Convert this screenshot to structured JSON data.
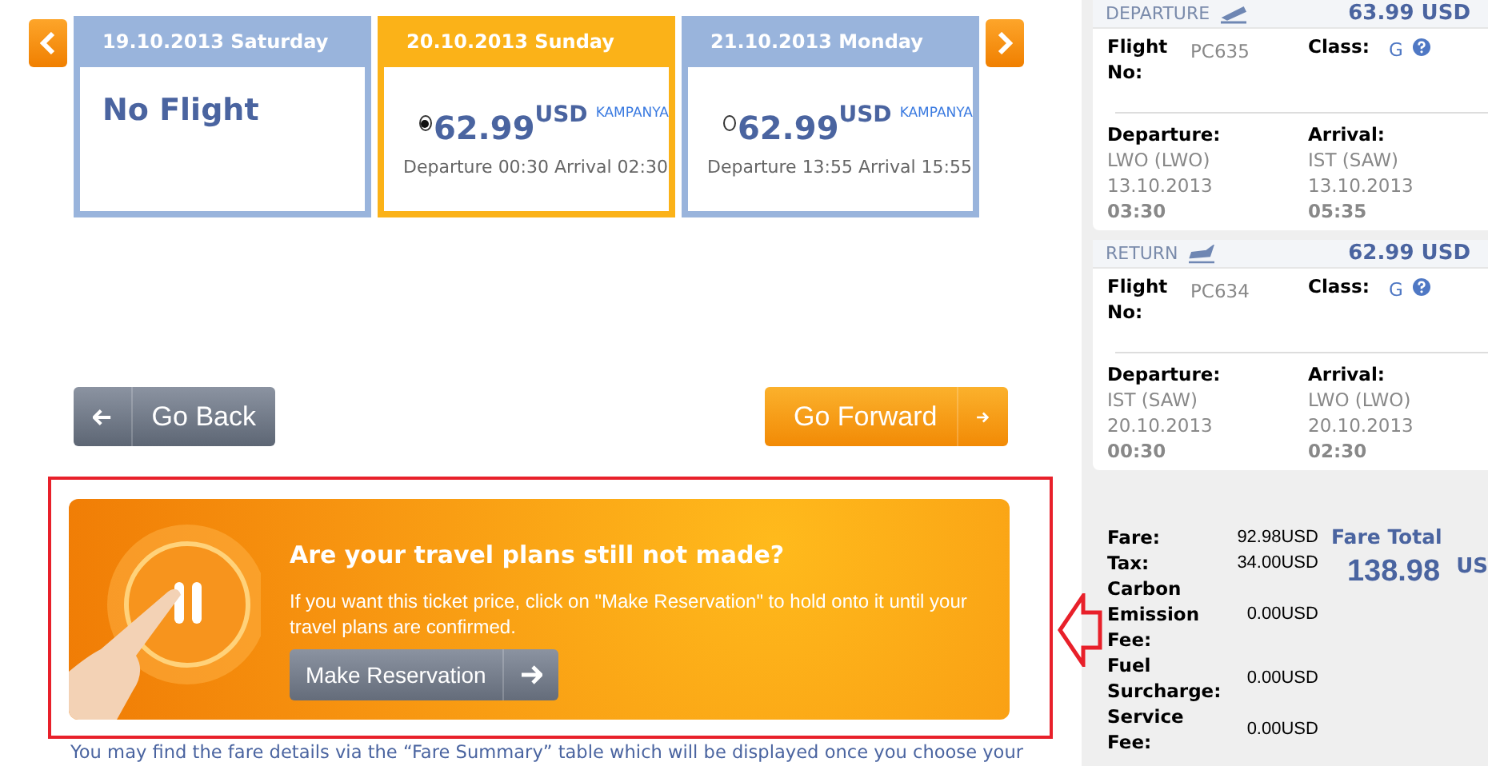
{
  "days": [
    {
      "kind": "no_flight",
      "date": "19.10.2013 Saturday",
      "selected": false,
      "message": "No Flight"
    },
    {
      "kind": "fare",
      "date": "20.10.2013 Sunday",
      "selected": true,
      "price": "62.99",
      "currency": "USD",
      "tag": "KAMPANYA",
      "times": "Departure 00:30 Arrival 02:30"
    },
    {
      "kind": "fare",
      "date": "21.10.2013 Monday",
      "selected": false,
      "price": "62.99",
      "currency": "USD",
      "tag": "KAMPANYA",
      "times": "Departure 13:55 Arrival 15:55"
    }
  ],
  "buttons": {
    "back": "Go Back",
    "forward": "Go Forward"
  },
  "banner": {
    "title": "Are your travel plans still not made?",
    "text": "If you want this ticket price, click on \"Make Reservation\" to hold onto it until your travel plans are confirmed.",
    "button": "Make Reservation"
  },
  "footer_note": "You may find the fare details via the “Fare Summary” table which will be displayed once you choose your",
  "flights": [
    {
      "kind": "departure",
      "direction": "DEPARTURE",
      "price": "63.99 USD",
      "flight_no_label": "Flight No:",
      "flight_no": "PC635",
      "class_label": "Class:",
      "class": "G",
      "departure_label": "Departure:",
      "departure_airport": "LWO (LWO)",
      "departure_date": "13.10.2013",
      "departure_time": "03:30",
      "arrival_label": "Arrival:",
      "arrival_airport": "IST (SAW)",
      "arrival_date": "13.10.2013",
      "arrival_time": "05:35"
    },
    {
      "kind": "return",
      "direction": "RETURN",
      "price": "62.99 USD",
      "flight_no_label": "Flight No:",
      "flight_no": "PC634",
      "class_label": "Class:",
      "class": "G",
      "departure_label": "Departure:",
      "departure_airport": "IST (SAW)",
      "departure_date": "20.10.2013",
      "departure_time": "00:30",
      "arrival_label": "Arrival:",
      "arrival_airport": "LWO (LWO)",
      "arrival_date": "20.10.2013",
      "arrival_time": "02:30"
    }
  ],
  "fare_summary": {
    "rows": [
      {
        "label": "Fare:",
        "value": "92.98USD"
      },
      {
        "label": "Tax:",
        "value": "34.00USD"
      },
      {
        "label": "Carbon Emission Fee:",
        "value": "0.00USD"
      },
      {
        "label": "Fuel Surcharge:",
        "value": "0.00USD"
      },
      {
        "label": "Service Fee:",
        "value": "0.00USD"
      }
    ],
    "total_label": "Fare Total",
    "total": "138.98",
    "total_currency": "US"
  }
}
